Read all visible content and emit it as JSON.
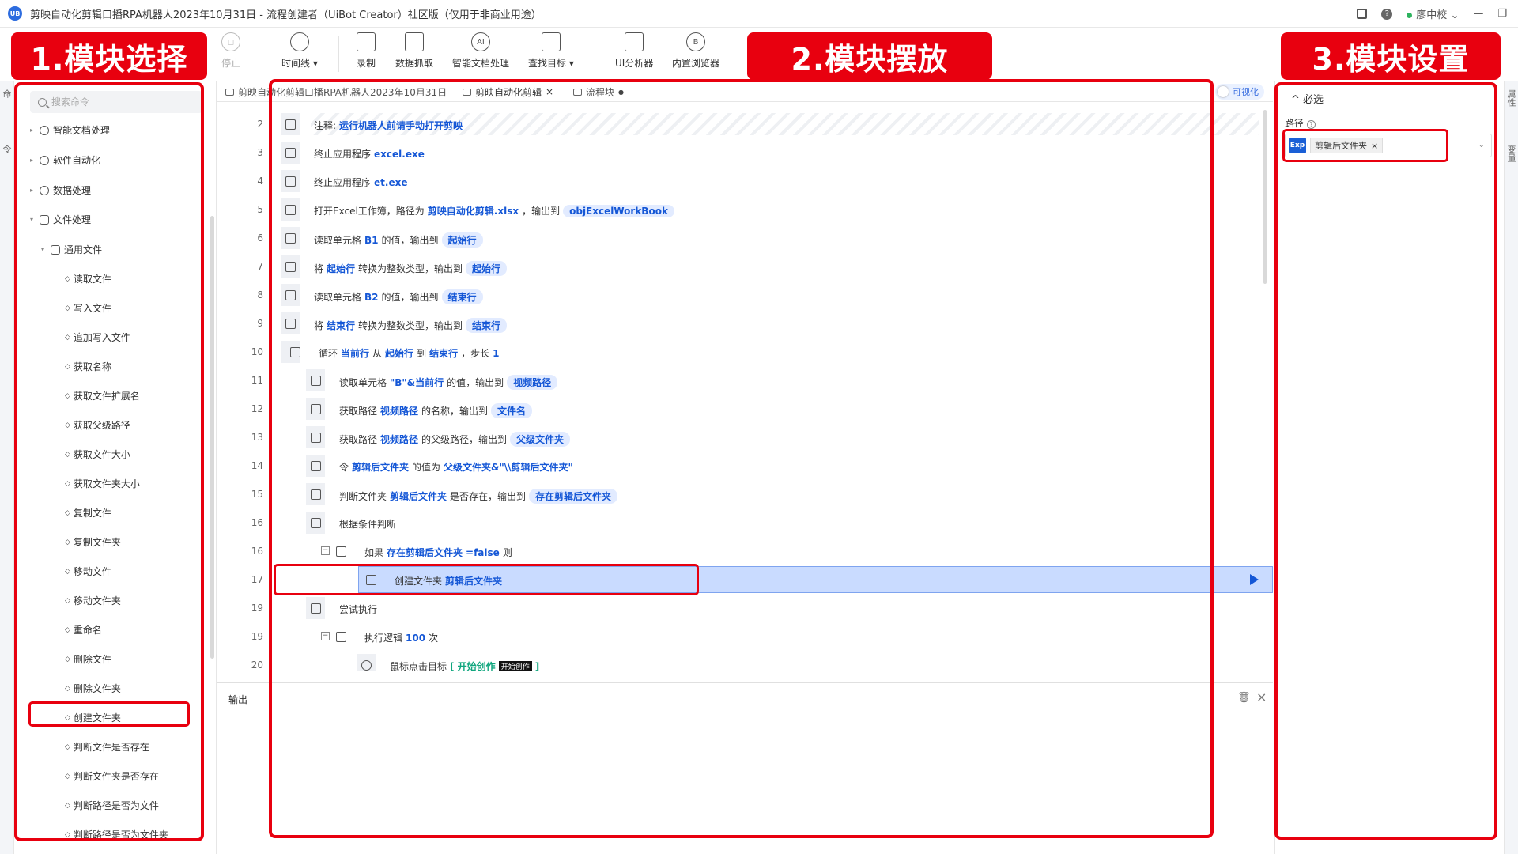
{
  "titlebar": {
    "app_logo": "UB",
    "title": "剪映自动化剪辑口播RPA机器人2023年10月31日 - 流程创建者（UiBot Creator）社区版（仅用于非商业用途）",
    "user": "廖中校",
    "help": "?",
    "grid_icon": "grid-icon",
    "chevron_down": "⌄",
    "minimize": "—",
    "restore": "❐"
  },
  "toolbar": {
    "stop": "停止",
    "timeline": "时间线",
    "record": "录制",
    "data_capture": "数据抓取",
    "doc_ai": "智能文档处理",
    "find_target": "查找目标",
    "ui_analyzer": "UI分析器",
    "browser": "内置浏览器"
  },
  "left_rail": {
    "tab1": "命",
    "tab2": "令"
  },
  "right_rail": {
    "tab1": "属性",
    "tab2": "变量"
  },
  "sidebar": {
    "search_placeholder": "搜索命令",
    "categories": [
      "智能文档处理",
      "软件自动化",
      "数据处理",
      "文件处理",
      "通用文件"
    ],
    "items": [
      "读取文件",
      "写入文件",
      "追加写入文件",
      "获取名称",
      "获取文件扩展名",
      "获取父级路径",
      "获取文件大小",
      "获取文件夹大小",
      "复制文件",
      "复制文件夹",
      "移动文件",
      "移动文件夹",
      "重命名",
      "删除文件",
      "删除文件夹",
      "创建文件夹",
      "判断文件是否存在",
      "判断文件夹是否存在",
      "判断路径是否为文件",
      "判断路径是否为文件夹"
    ]
  },
  "editor": {
    "tabs": [
      "剪映自动化剪辑口播RPA机器人2023年10月31日",
      "剪映自动化剪辑",
      "流程块"
    ],
    "tab_close": "×",
    "tab_dot": "●",
    "visualize": "可视化",
    "lines": {
      "l2": "2",
      "l3": "3",
      "l4": "4",
      "l5": "5",
      "l6": "6",
      "l7": "7",
      "l8": "8",
      "l9": "9",
      "l10": "10",
      "l11": "11",
      "l12": "12",
      "l13": "13",
      "l14": "14",
      "l15": "15",
      "l16a": "16",
      "l16b": "16",
      "l17": "17",
      "l19a": "19",
      "l19b": "19",
      "l20": "20"
    },
    "fold_minus": "−",
    "s2": {
      "a": "注释:",
      "b": "运行机器人前请手动打开剪映"
    },
    "s3": {
      "a": "终止应用程序",
      "b": "excel.exe"
    },
    "s4": {
      "a": "终止应用程序",
      "b": "et.exe"
    },
    "s5": {
      "a": "打开Excel工作簿，路径为",
      "b": "剪映自动化剪辑.xlsx",
      "c": "，输出到",
      "d": "objExcelWorkBook"
    },
    "s6": {
      "a": "读取单元格",
      "b": "B1",
      "c": "的值，输出到",
      "d": "起始行"
    },
    "s7": {
      "a": "将",
      "b": "起始行",
      "c": "转换为整数类型，输出到",
      "d": "起始行"
    },
    "s8": {
      "a": "读取单元格",
      "b": "B2",
      "c": "的值，输出到",
      "d": "结束行"
    },
    "s9": {
      "a": "将",
      "b": "结束行",
      "c": "转换为整数类型，输出到",
      "d": "结束行"
    },
    "s10": {
      "a": "循环",
      "b": "当前行",
      "c": "从",
      "d": "起始行",
      "e": "到",
      "f": "结束行",
      "g": "，步长",
      "h": "1"
    },
    "s11": {
      "a": "读取单元格",
      "b": "\"B\"&当前行",
      "c": "的值，输出到",
      "d": "视频路径"
    },
    "s12": {
      "a": "获取路径",
      "b": "视频路径",
      "c": "的名称，输出到",
      "d": "文件名"
    },
    "s13": {
      "a": "获取路径",
      "b": "视频路径",
      "c": "的父级路径，输出到",
      "d": "父级文件夹"
    },
    "s14": {
      "a": "令",
      "b": "剪辑后文件夹",
      "c": "的值为",
      "d": "父级文件夹&\"\\\\剪辑后文件夹\""
    },
    "s15": {
      "a": "判断文件夹",
      "b": "剪辑后文件夹",
      "c": "是否存在，输出到",
      "d": "存在剪辑后文件夹"
    },
    "s16a": {
      "a": "根据条件判断"
    },
    "s16b": {
      "a": "如果",
      "b": "存在剪辑后文件夹",
      "c": "=false",
      "d": "则"
    },
    "s17": {
      "a": "创建文件夹",
      "b": "剪辑后文件夹"
    },
    "s19a": {
      "a": "尝试执行"
    },
    "s19b": {
      "a": "执行逻辑",
      "b": "100",
      "c": "次"
    },
    "s20": {
      "a": "鼠标点击目标",
      "b": "[ 开始创作",
      "c": "开始创作",
      "d": "]"
    }
  },
  "output": {
    "label": "输出",
    "trash": "🗑",
    "close": "×"
  },
  "props": {
    "required": "必选",
    "path_label": "路径",
    "help": "?",
    "exp": "Exp",
    "chip_value": "剪辑后文件夹",
    "chip_close": "×",
    "expand_glyph": "^",
    "dropdown": "⌄"
  },
  "annotations": {
    "label1": "1.模块选择",
    "label2": "2.模块摆放",
    "label3": "3.模块设置"
  },
  "colors": {
    "accent": "#1557d6",
    "annotation_red": "#e8000f",
    "selected_row": "#c9dbff"
  }
}
